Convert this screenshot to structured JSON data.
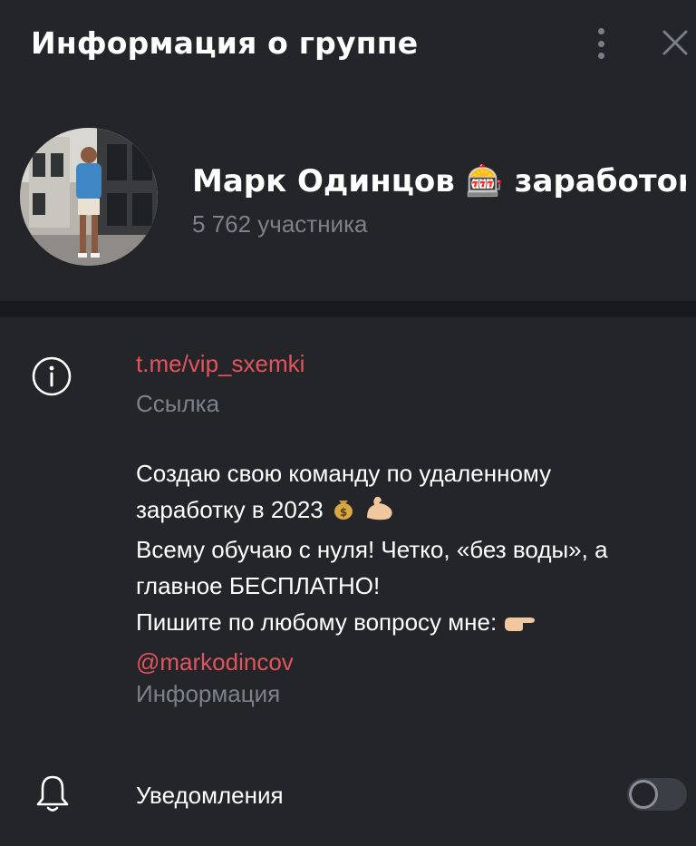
{
  "header": {
    "title": "Информация о группе"
  },
  "group": {
    "name": "Марк Одинцов 🎰 заработок ...",
    "members": "5 762 участника"
  },
  "link": {
    "value": "t.me/vip_sxemki",
    "caption": "Ссылка"
  },
  "description": {
    "line1": "Создаю свою команду по удаленному",
    "line2": "заработку в 2023",
    "line3": "Всему обучаю с нуля! Четко, «без воды», а",
    "line4": "главное БЕСПЛАТНО!",
    "line5": "Пишите по любому вопросу мне:",
    "mention": "@markodincov",
    "caption": "Информация"
  },
  "notifications": {
    "label": "Уведомления",
    "enabled": false
  },
  "icons": {
    "menu": "more-vertical-icon",
    "close": "close-icon",
    "info": "info-icon",
    "bell": "bell-icon"
  },
  "colors": {
    "background": "#232529",
    "accent": "#e2555e",
    "secondary_text": "#7d828a",
    "divider": "#17191c"
  }
}
